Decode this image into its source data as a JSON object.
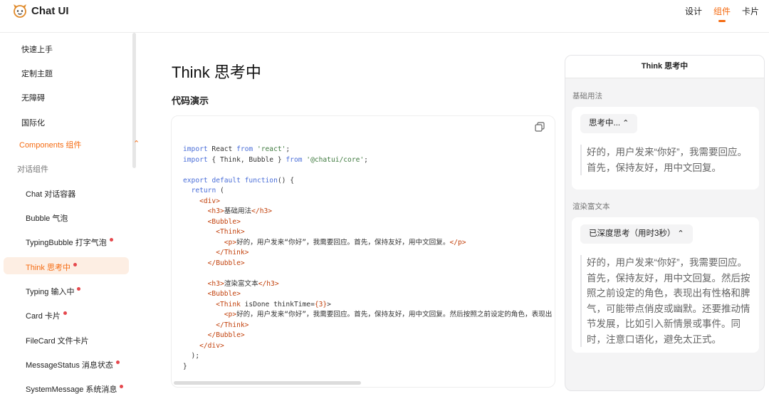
{
  "header": {
    "brand": "Chat UI",
    "nav": [
      "设计",
      "组件",
      "卡片"
    ],
    "active_nav": "组件",
    "accent": "#f56b12"
  },
  "sidebar": {
    "top_items": [
      "快速上手",
      "定制主题",
      "无障碍",
      "国际化"
    ],
    "group": "Components 组件",
    "category": "对话组件",
    "items": [
      {
        "label": "Chat 对话容器",
        "dot": false
      },
      {
        "label": "Bubble 气泡",
        "dot": false
      },
      {
        "label": "TypingBubble 打字气泡",
        "dot": true
      },
      {
        "label": "Think 思考中",
        "dot": true,
        "active": true
      },
      {
        "label": "Typing 输入中",
        "dot": true
      },
      {
        "label": "Card 卡片",
        "dot": true
      },
      {
        "label": "FileCard 文件卡片",
        "dot": false
      },
      {
        "label": "MessageStatus 消息状态",
        "dot": true
      },
      {
        "label": "SystemMessage 系统消息",
        "dot": true
      }
    ]
  },
  "main": {
    "title": "Think 思考中",
    "section": "代码演示",
    "code_lines": [
      "import React from 'react';",
      "import { Think, Bubble } from '@chatui/core';",
      "",
      "export default function() {",
      "  return (",
      "    <div>",
      "      <h3>基础用法</h3>",
      "      <Bubble>",
      "        <Think>",
      "          <p>好的，用户发来“你好”，我需要回应。首先，保持友好，用中文回复。</p>",
      "        </Think>",
      "      </Bubble>",
      "",
      "      <h3>渲染富文本</h3>",
      "      <Bubble>",
      "        <Think isDone thinkTime={3}>",
      "          <p>好的，用户发来“你好”，我需要回应。首先，保持友好，用中文回复。然后按照之前设定的角色，表现出",
      "        </Think>",
      "      </Bubble>",
      "    </div>",
      "  );",
      "}"
    ]
  },
  "demo": {
    "header": "Think 思考中",
    "basic_label": "基础用法",
    "basic_button": "思考中...",
    "basic_text": [
      "好的，用户发来“你好”，我需要回应。",
      "首先，保持友好，用中文回复。"
    ],
    "rich_label": "渲染富文本",
    "rich_button": "已深度思考（用时3秒）",
    "rich_text": [
      "好的，用户发来“你好”，我需要回应。",
      "首先，保持友好，用中文回复。然后按",
      "照之前设定的角色，表现出有性格和脾",
      "气，可能带点俏皮或幽默。还要推动情",
      "节发展，比如引入新情景或事件。同",
      "时，注意口语化，避免太正式。"
    ]
  }
}
